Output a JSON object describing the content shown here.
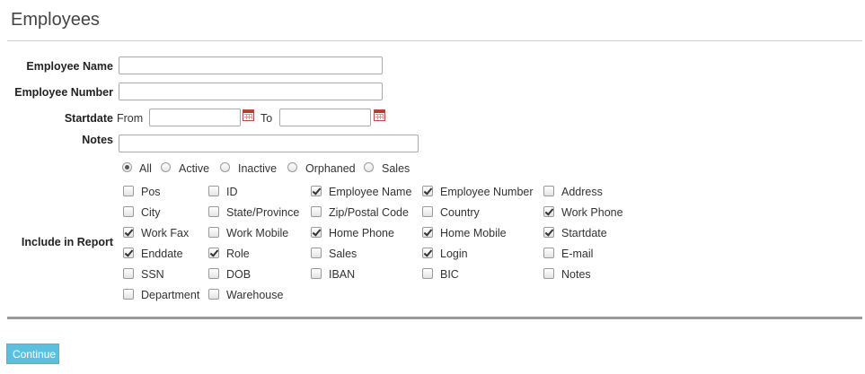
{
  "page": {
    "title": "Employees"
  },
  "form": {
    "employee_name": {
      "label": "Employee Name",
      "value": "",
      "placeholder": ""
    },
    "employee_number": {
      "label": "Employee Number",
      "value": "",
      "placeholder": ""
    },
    "startdate": {
      "label": "Startdate",
      "from_label": "From",
      "to_label": "To",
      "from_value": "",
      "to_value": ""
    },
    "notes": {
      "label": "Notes",
      "value": ""
    },
    "status_filter": {
      "options": [
        "All",
        "Active",
        "Inactive",
        "Orphaned",
        "Sales"
      ],
      "selected": "All"
    },
    "include_in_report": {
      "label": "Include in Report",
      "options": [
        {
          "label": "Pos",
          "checked": false
        },
        {
          "label": "ID",
          "checked": false
        },
        {
          "label": "Employee Name",
          "checked": true
        },
        {
          "label": "Employee Number",
          "checked": true
        },
        {
          "label": "Address",
          "checked": false
        },
        {
          "label": "City",
          "checked": false
        },
        {
          "label": "State/Province",
          "checked": false
        },
        {
          "label": "Zip/Postal Code",
          "checked": false
        },
        {
          "label": "Country",
          "checked": false
        },
        {
          "label": "Work Phone",
          "checked": true
        },
        {
          "label": "Work Fax",
          "checked": true
        },
        {
          "label": "Work Mobile",
          "checked": false
        },
        {
          "label": "Home Phone",
          "checked": true
        },
        {
          "label": "Home Mobile",
          "checked": true
        },
        {
          "label": "Startdate",
          "checked": true
        },
        {
          "label": "Enddate",
          "checked": true
        },
        {
          "label": "Role",
          "checked": true
        },
        {
          "label": "Sales",
          "checked": false
        },
        {
          "label": "Login",
          "checked": true
        },
        {
          "label": "E-mail",
          "checked": false
        },
        {
          "label": "SSN",
          "checked": false
        },
        {
          "label": "DOB",
          "checked": false
        },
        {
          "label": "IBAN",
          "checked": false
        },
        {
          "label": "BIC",
          "checked": false
        },
        {
          "label": "Notes",
          "checked": false
        },
        {
          "label": "Department",
          "checked": false
        },
        {
          "label": "Warehouse",
          "checked": false
        }
      ]
    }
  },
  "actions": {
    "continue_label": "Continue"
  },
  "colors": {
    "button_bg": "#5bc0de",
    "divider": "#9a9a9a"
  },
  "icons": {
    "calendar": "calendar-icon"
  }
}
